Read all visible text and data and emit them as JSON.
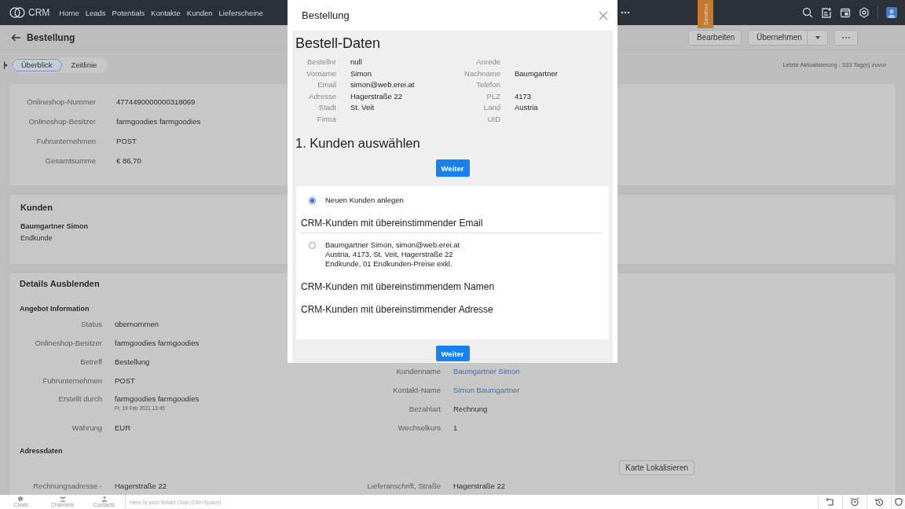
{
  "nav": {
    "brand": "CRM",
    "items": [
      "Home",
      "Leads",
      "Potentials",
      "Kontakte",
      "Kunden",
      "Lieferscheine"
    ]
  },
  "sandbox": "Sandbox",
  "header": {
    "title": "Bestellung",
    "buttons": [
      "Bearbeiten",
      "Übernehmen"
    ]
  },
  "tabs": [
    {
      "label": "Überblick",
      "selected": true
    },
    {
      "label": "Zeitlinie",
      "selected": false
    }
  ],
  "last_update": "Letzte Aktualisierung : 333 Tag(e) zuvor",
  "summary": [
    {
      "label": "Onlineshop-Nummer",
      "value": "4774490000000318069"
    },
    {
      "label": "Onlineshop-Besitzer",
      "value": "farmgoodies farmgoodies"
    },
    {
      "label": "Fuhrunternehmen",
      "value": "POST"
    },
    {
      "label": "Gesamtsumme",
      "value": "€ 86,70"
    }
  ],
  "customer": {
    "title": "Kunden",
    "name": "Baumgartner Simon",
    "type": "Endkunde"
  },
  "details": {
    "title": "Details Ausblenden",
    "section": "Angebot Information",
    "left": [
      {
        "label": "Status",
        "value": "übernommen"
      },
      {
        "label": "Onlineshop-Besitzer",
        "value": "farmgoodies farmgoodies"
      },
      {
        "label": "Betreff",
        "value": "Bestellung"
      },
      {
        "label": "Fuhrunternehmen",
        "value": "POST"
      },
      {
        "label": "Erstellt durch",
        "value": "farmgoodies farmgoodies",
        "sub": "Fr, 19 Feb 2021 13:45"
      },
      {
        "label": "Währung",
        "value": "EUR"
      }
    ],
    "right": [
      {
        "label": "Kundenname",
        "value": "Baumgartner Simon",
        "kind": "link"
      },
      {
        "label": "Kontakt-Name",
        "value": "Simon Baumgartner",
        "kind": "link"
      },
      {
        "label": "Bezahlart",
        "value": "Rechnung",
        "kind": "text"
      },
      {
        "label": "Wechselkurs",
        "value": "1",
        "kind": "text"
      }
    ],
    "address_title": "Adressdaten",
    "map_button": "Karte Lokalisieren",
    "address_left": [
      {
        "label": "Rechnungsadresse -",
        "value": "Hagerstraße 22"
      }
    ],
    "address_right": [
      {
        "label": "Lieferanschrift, Straße",
        "value": "Hagerstraße 22"
      }
    ]
  },
  "modal": {
    "title": "Bestellung",
    "heading": "Bestell-Daten",
    "fields": [
      {
        "label": "Bestellnr",
        "value": "null"
      },
      {
        "label": "Anrede"
      },
      {
        "label": "Vorname",
        "value": "Simon"
      },
      {
        "label": "Nachname",
        "value": "Baumgartner"
      },
      {
        "label": "Email",
        "value": "simon@web.erei.at"
      },
      {
        "label": "Telefon"
      },
      {
        "label": "Adresse",
        "value": "Hagerstraße 22"
      },
      {
        "label": "PLZ",
        "value": "4173"
      },
      {
        "label": "Stadt",
        "value": "St. Veit"
      },
      {
        "label": "Land",
        "value": "Austria"
      },
      {
        "label": "Firma"
      },
      {
        "label": "UID"
      }
    ],
    "step": "1. Kunden auswählen",
    "button": "Weiter",
    "options": [
      {
        "kind": "radio",
        "lines": [
          "Neuen Kunden anlegen"
        ],
        "selected": true
      },
      {
        "kind": "heading",
        "text": "CRM-Kunden mit übereinstimmender Email"
      },
      {
        "kind": "radio",
        "lines": [
          "Baumgartner Simon, simon@web.erei.at",
          "Austria, 4173, St. Veit, Hagerstraße 22",
          "Endkunde, 01 Endkunden-Preise exkl."
        ],
        "selected": false
      },
      {
        "kind": "heading",
        "text": "CRM-Kunden mit übereinstimmendem Namen"
      },
      {
        "kind": "heading",
        "text": "CRM-Kunden mit übereinstimmender Adresse"
      }
    ],
    "bottom_button": "Weiter"
  },
  "chat_bar": {
    "items": [
      "Chats",
      "Channels",
      "Contacts"
    ],
    "placeholder": "Here is your Smart Chat (Ctrl+Space)"
  }
}
